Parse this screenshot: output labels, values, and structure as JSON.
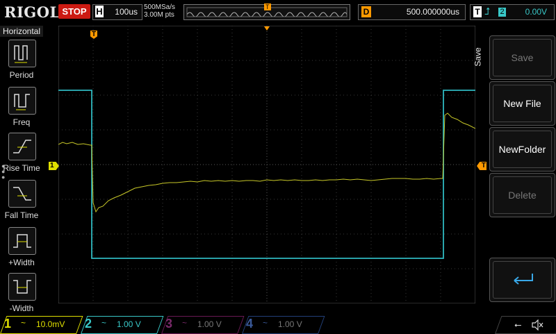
{
  "header": {
    "brand": "RIGOL",
    "run_state": "STOP",
    "timebase_label": "H",
    "timebase_value": "100us",
    "sample_rate": "500MSa/s",
    "memory_depth": "3.00M pts",
    "trigger_marker": "T",
    "delay_label": "D",
    "delay_value": "500.000000us",
    "trigger_label": "T",
    "trigger_source": "2",
    "trigger_level": "0.00V"
  },
  "left_menu": {
    "title": "Horizontal",
    "items": [
      {
        "label": "Period",
        "icon": "period-icon"
      },
      {
        "label": "Freq",
        "icon": "frequency-icon"
      },
      {
        "label": "Rise Time",
        "icon": "rise-time-icon"
      },
      {
        "label": "Fall Time",
        "icon": "fall-time-icon"
      },
      {
        "label": "+Width",
        "icon": "positive-width-icon"
      },
      {
        "label": "-Width",
        "icon": "negative-width-icon"
      }
    ]
  },
  "right_menu": {
    "tab_label": "Save",
    "buttons": [
      {
        "label": "Save",
        "enabled": false
      },
      {
        "label": "New File",
        "enabled": true
      },
      {
        "label": "NewFolder",
        "enabled": true
      },
      {
        "label": "Delete",
        "enabled": false
      },
      {
        "label": "",
        "enabled": true,
        "icon": "return-arrow-icon"
      }
    ]
  },
  "markers": {
    "trigger_position": "T",
    "ch1_ground": "1",
    "trigger_level": "T"
  },
  "channels": [
    {
      "num": "1",
      "coupling": "~",
      "scale": "10.0mV",
      "color": "#e0e000",
      "active": true
    },
    {
      "num": "2",
      "coupling": "~",
      "scale": "1.00 V",
      "color": "#39c8c8",
      "active": true
    },
    {
      "num": "3",
      "coupling": "~",
      "scale": "1.00 V",
      "color": "#b0208c",
      "active": false
    },
    {
      "num": "4",
      "coupling": "~",
      "scale": "1.00 V",
      "color": "#3a60c8",
      "active": false
    }
  ],
  "status_icons": [
    "usb-icon",
    "mute-icon"
  ],
  "colors": {
    "ch1": "#c8c828",
    "ch2": "#39c8c8",
    "stop": "#cc1a12",
    "delay": "#ff9900"
  }
}
